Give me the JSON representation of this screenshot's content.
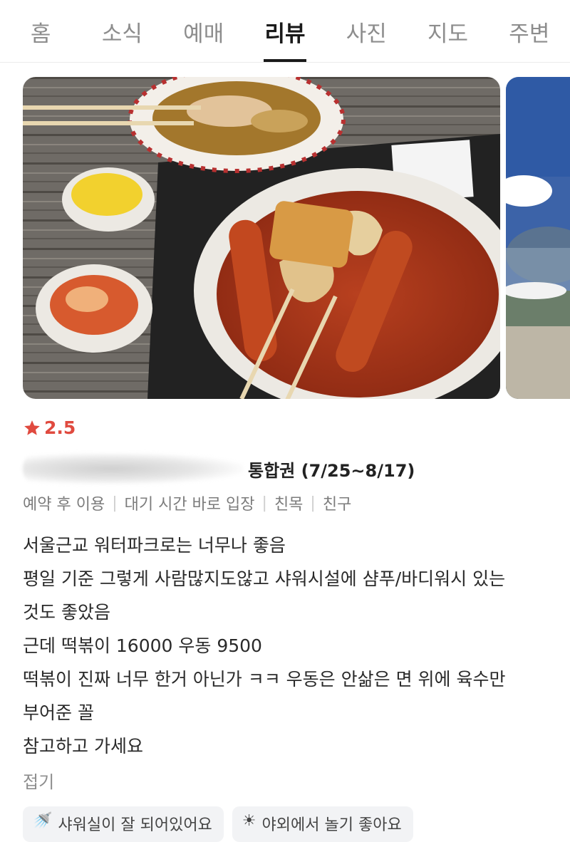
{
  "tabs": [
    {
      "label": "홈",
      "active": false
    },
    {
      "label": "소식",
      "active": false
    },
    {
      "label": "예매",
      "active": false
    },
    {
      "label": "리뷰",
      "active": true
    },
    {
      "label": "사진",
      "active": false
    },
    {
      "label": "지도",
      "active": false
    },
    {
      "label": "주변",
      "active": false
    }
  ],
  "review": {
    "rating": "2.5",
    "ticket_name": "통합권 (7/25~8/17)",
    "tags": [
      "예약 후 이용",
      "대기 시간 바로 입장",
      "친목",
      "친구"
    ],
    "body_lines": [
      "서울근교 워터파크로는 너무나 좋음",
      "평일 기준 그렇게 사람많지도않고 샤워시설에 샴푸/바디워시 있는",
      "것도 좋았음",
      "근데 떡볶이 16000 우동 9500",
      "떡볶이 진짜 너무 한거 아닌가 ㅋㅋ 우동은 안삶은 면 위에 육수만",
      "부어준 꼴",
      "참고하고 가세요"
    ],
    "fold_label": "접기",
    "keyword_chips": [
      {
        "icon": "shower-icon",
        "label": "샤워실이 잘 되어있어요"
      },
      {
        "icon": "sun-icon",
        "label": "야외에서 놀기 좋아요"
      }
    ]
  },
  "colors": {
    "accent": "#e04a3f",
    "active_tab": "#1a1a1a",
    "inactive_tab": "#8d8d8d"
  }
}
